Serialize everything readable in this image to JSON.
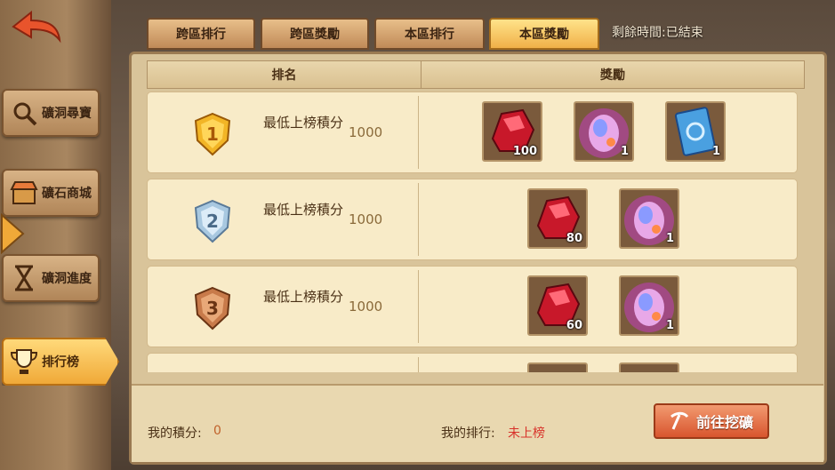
{
  "tabs": [
    {
      "label": "跨區排行",
      "active": false
    },
    {
      "label": "跨區獎勵",
      "active": false
    },
    {
      "label": "本區排行",
      "active": false
    },
    {
      "label": "本區獎勵",
      "active": true
    }
  ],
  "remaining_time": "剩餘時間:已結束",
  "sidebar": {
    "items": [
      {
        "label": "礦洞尋寶",
        "icon": "treasure-search-icon"
      },
      {
        "label": "礦石商城",
        "icon": "shop-icon"
      },
      {
        "label": "礦洞進度",
        "icon": "hourglass-icon"
      },
      {
        "label": "排行榜",
        "icon": "trophy-icon",
        "active": true
      }
    ]
  },
  "table": {
    "header_rank": "排名",
    "header_reward": "獎勵",
    "rows": [
      {
        "rank": 1,
        "label": "最低上榜積分",
        "value": "1000",
        "rewards": [
          {
            "type": "red-ore",
            "qty": "100"
          },
          {
            "type": "egg",
            "qty": "1"
          },
          {
            "type": "blue-card",
            "qty": "1"
          }
        ]
      },
      {
        "rank": 2,
        "label": "最低上榜積分",
        "value": "1000",
        "rewards": [
          {
            "type": "red-ore",
            "qty": "80"
          },
          {
            "type": "egg",
            "qty": "1"
          }
        ]
      },
      {
        "rank": 3,
        "label": "最低上榜積分",
        "value": "1000",
        "rewards": [
          {
            "type": "red-ore",
            "qty": "60"
          },
          {
            "type": "egg",
            "qty": "1"
          }
        ]
      }
    ]
  },
  "footer": {
    "my_score_label": "我的積分:",
    "my_score_value": "0",
    "my_rank_label": "我的排行:",
    "my_rank_value": "未上榜",
    "go_button": "前往挖礦"
  },
  "colors": {
    "score_value": "#c0612a",
    "rank_value": "#d8322a",
    "accent_gold": "#f0b048"
  }
}
